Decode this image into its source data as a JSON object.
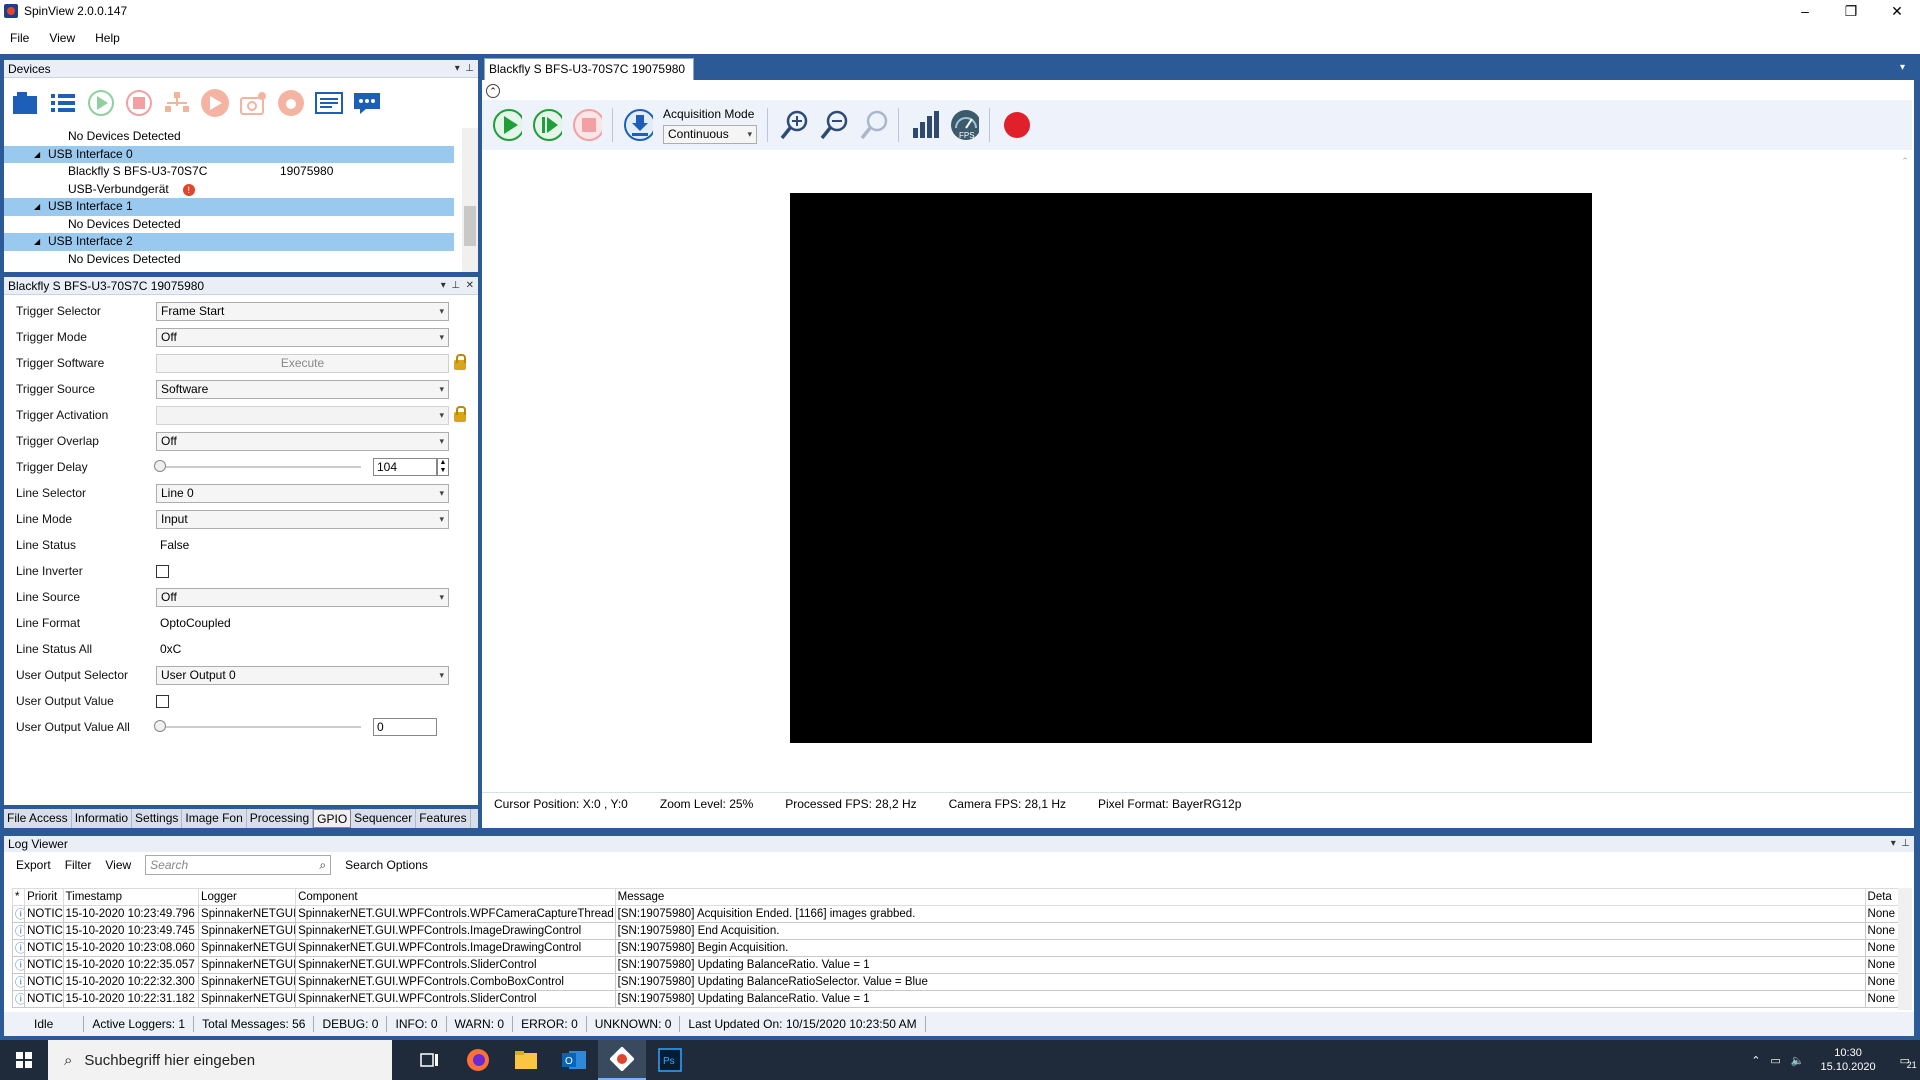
{
  "window": {
    "title": "SpinView 2.0.0.147",
    "minimize": "–",
    "restore": "❐",
    "close": "✕"
  },
  "menu": [
    "File",
    "View",
    "Help"
  ],
  "devices_panel": {
    "title": "Devices",
    "tree": [
      {
        "text": "No Devices Detected",
        "indent": 2,
        "selected": false
      },
      {
        "text": "USB Interface 0",
        "indent": 1,
        "selected": true,
        "expander": "◢"
      },
      {
        "text": "Blackfly S BFS-U3-70S7C",
        "serial": "19075980",
        "indent": 2,
        "selected": false
      },
      {
        "text": "USB-Verbundgerät",
        "indent": 2,
        "selected": false,
        "badge": "!"
      },
      {
        "text": "USB Interface 1",
        "indent": 1,
        "selected": true,
        "expander": "◢"
      },
      {
        "text": "No Devices Detected",
        "indent": 2,
        "selected": false
      },
      {
        "text": "USB Interface 2",
        "indent": 1,
        "selected": true,
        "expander": "◢"
      },
      {
        "text": "No Devices Detected",
        "indent": 2,
        "selected": false
      }
    ]
  },
  "properties_panel": {
    "title": "Blackfly S BFS-U3-70S7C 19075980",
    "rows": [
      {
        "label": "Trigger Selector",
        "type": "combo",
        "value": "Frame Start"
      },
      {
        "label": "Trigger Mode",
        "type": "combo",
        "value": "Off"
      },
      {
        "label": "Trigger Software",
        "type": "button",
        "value": "Execute",
        "locked": true
      },
      {
        "label": "Trigger Source",
        "type": "combo",
        "value": "Software"
      },
      {
        "label": "Trigger Activation",
        "type": "combo-disabled",
        "value": "",
        "locked": true
      },
      {
        "label": "Trigger Overlap",
        "type": "combo",
        "value": "Off"
      },
      {
        "label": "Trigger Delay",
        "type": "slider",
        "value": "104"
      },
      {
        "label": "Line Selector",
        "type": "combo",
        "value": "Line 0"
      },
      {
        "label": "Line Mode",
        "type": "combo",
        "value": "Input"
      },
      {
        "label": "Line Status",
        "type": "text",
        "value": "False"
      },
      {
        "label": "Line Inverter",
        "type": "check",
        "value": ""
      },
      {
        "label": "Line Source",
        "type": "combo",
        "value": "Off"
      },
      {
        "label": "Line Format",
        "type": "text",
        "value": "OptoCoupled"
      },
      {
        "label": "Line Status All",
        "type": "text",
        "value": "0xC"
      },
      {
        "label": "User Output Selector",
        "type": "combo",
        "value": "User Output 0"
      },
      {
        "label": "User Output Value",
        "type": "check",
        "value": ""
      },
      {
        "label": "User Output Value All",
        "type": "slider-plain",
        "value": "0"
      }
    ],
    "tabs": [
      {
        "label": "File Access",
        "active": false
      },
      {
        "label": "Informatio",
        "active": false
      },
      {
        "label": "Settings",
        "active": false
      },
      {
        "label": "Image Fon",
        "active": false
      },
      {
        "label": "Processing",
        "active": false
      },
      {
        "label": "GPIO",
        "active": true
      },
      {
        "label": "Sequencer",
        "active": false
      },
      {
        "label": "Features",
        "active": false
      }
    ]
  },
  "display": {
    "tab_title": "Blackfly S BFS-U3-70S7C 19075980",
    "tab_close": "✕",
    "acquisition_mode_label": "Acquisition Mode",
    "acquisition_mode_value": "Continuous",
    "status": {
      "cursor": "Cursor Position: X:0 , Y:0",
      "zoom": "Zoom Level: 25%",
      "processed_fps": "Processed FPS: 28,2 Hz",
      "camera_fps": "Camera FPS: 28,1 Hz",
      "pixel_format": "Pixel Format: BayerRG12p"
    }
  },
  "log_viewer": {
    "title": "Log Viewer",
    "toolbar": [
      "Export",
      "Filter",
      "View"
    ],
    "search_placeholder": "Search",
    "search_options": "Search Options",
    "columns": [
      "*",
      "Priorit",
      "Timestamp",
      "Logger",
      "Component",
      "Message",
      "Deta"
    ],
    "rows": [
      [
        "ⓘ",
        "NOTICE",
        "15-10-2020 10:23:49.796",
        "SpinnakerNETGUI",
        "SpinnakerNET.GUI.WPFControls.WPFCameraCaptureThread",
        "[SN:19075980] Acquisition Ended. [1166] images grabbed.",
        "None"
      ],
      [
        "ⓘ",
        "NOTICE",
        "15-10-2020 10:23:49.745",
        "SpinnakerNETGUI",
        "SpinnakerNET.GUI.WPFControls.ImageDrawingControl",
        "[SN:19075980] End Acquisition.",
        "None"
      ],
      [
        "ⓘ",
        "NOTICE",
        "15-10-2020 10:23:08.060",
        "SpinnakerNETGUI",
        "SpinnakerNET.GUI.WPFControls.ImageDrawingControl",
        "[SN:19075980] Begin Acquisition.",
        "None"
      ],
      [
        "ⓘ",
        "NOTICE",
        "15-10-2020 10:22:35.057",
        "SpinnakerNETGUI",
        "SpinnakerNET.GUI.WPFControls.SliderControl",
        "[SN:19075980] Updating BalanceRatio. Value = 1",
        "None"
      ],
      [
        "ⓘ",
        "NOTICE",
        "15-10-2020 10:22:32.300",
        "SpinnakerNETGUI",
        "SpinnakerNET.GUI.WPFControls.ComboBoxControl",
        "[SN:19075980] Updating BalanceRatioSelector. Value = Blue",
        "None"
      ],
      [
        "ⓘ",
        "NOTICE",
        "15-10-2020 10:22:31.182",
        "SpinnakerNETGUI",
        "SpinnakerNET.GUI.WPFControls.SliderControl",
        "[SN:19075980] Updating BalanceRatio. Value = 1",
        "None"
      ]
    ],
    "status": [
      "Idle",
      "Active Loggers: 1",
      "Total Messages: 56",
      "DEBUG: 0",
      "INFO: 0",
      "WARN: 0",
      "ERROR: 0",
      "UNKNOWN: 0",
      "Last Updated On: 10/15/2020 10:23:50 AM"
    ]
  },
  "taskbar": {
    "search_placeholder": "Suchbegriff hier eingeben",
    "time": "10:30",
    "date": "15.10.2020",
    "notification_count": "21"
  },
  "colors": {
    "accent": "#2b5a97",
    "selection": "#99c9ef",
    "play_green": "#1f9e3a",
    "stop_red": "#e0202a"
  }
}
